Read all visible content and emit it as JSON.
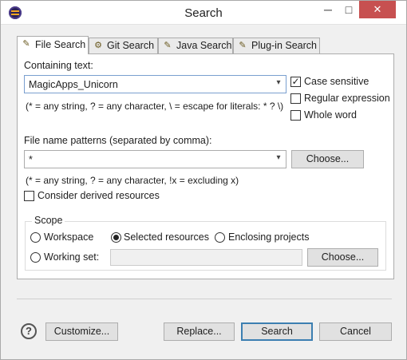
{
  "window": {
    "title": "Search",
    "minimize_glyph": "─",
    "maximize_glyph": "□",
    "close_glyph": "✕",
    "app_icon": "eclipse-icon"
  },
  "tabs": [
    {
      "label": "File Search",
      "icon": "file-search-icon",
      "active": true
    },
    {
      "label": "Git Search",
      "icon": "git-search-icon",
      "active": false
    },
    {
      "label": "Java Search",
      "icon": "java-search-icon",
      "active": false
    },
    {
      "label": "Plug-in Search",
      "icon": "plugin-search-icon",
      "active": false
    }
  ],
  "containing_text": {
    "label": "Containing text:",
    "value": "MagicApps_Unicorn",
    "hint": "(* = any string, ? = any character, \\ = escape for literals: * ? \\)"
  },
  "options": {
    "case_sensitive": {
      "label": "Case sensitive",
      "checked": true
    },
    "regular_expression": {
      "label": "Regular expression",
      "checked": false
    },
    "whole_word": {
      "label": "Whole word",
      "checked": false
    }
  },
  "file_patterns": {
    "label": "File name patterns (separated by comma):",
    "value": "*",
    "choose_label": "Choose...",
    "hint": "(* = any string, ? = any character, !x = excluding x)"
  },
  "derived": {
    "label": "Consider derived resources",
    "checked": false
  },
  "scope": {
    "title": "Scope",
    "workspace_label": "Workspace",
    "selected_resources_label": "Selected resources",
    "enclosing_projects_label": "Enclosing projects",
    "working_set_label": "Working set:",
    "working_set_value": "",
    "choose_label": "Choose...",
    "selected": "Selected resources"
  },
  "footer": {
    "help_glyph": "?",
    "customize_label": "Customize...",
    "replace_label": "Replace...",
    "search_label": "Search",
    "cancel_label": "Cancel"
  },
  "colors": {
    "default_button_border": "#3c7fb1",
    "close_button": "#c75050",
    "focused_field_border": "#7a9fcf"
  }
}
